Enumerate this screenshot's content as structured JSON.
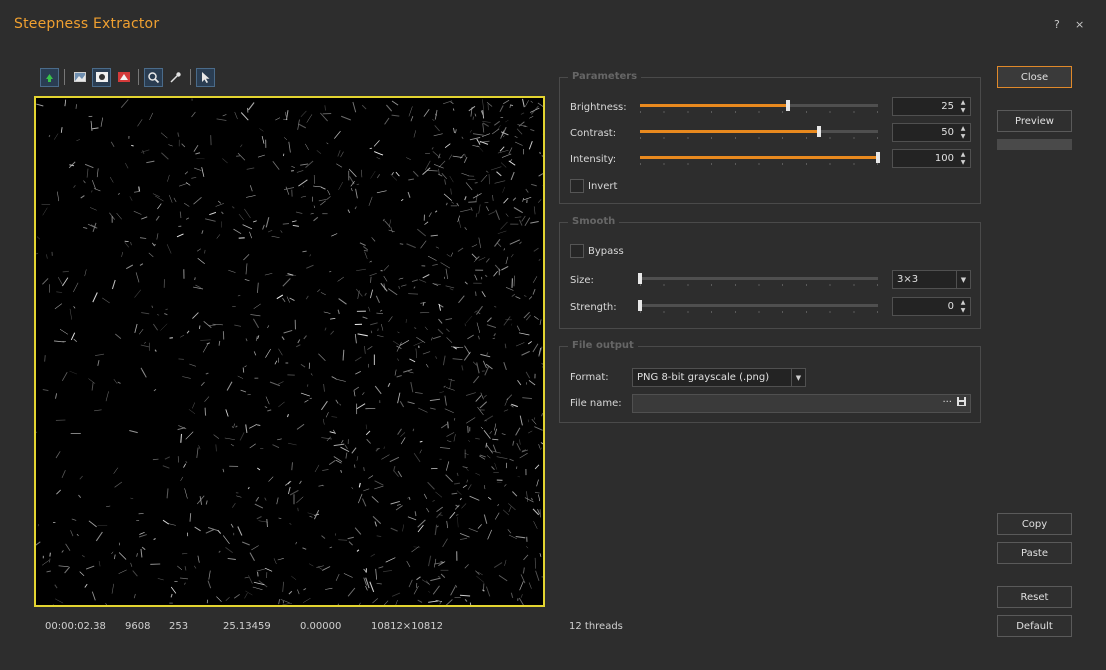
{
  "window": {
    "title": "Steepness Extractor",
    "help_label": "?",
    "close_label": "×"
  },
  "toolbar": {
    "icons": [
      "green-arrow-icon",
      "image-icon",
      "image-swap-icon",
      "image-red-icon",
      "zoom-icon",
      "eyedropper-icon",
      "pointer-icon"
    ]
  },
  "status": {
    "time": "00:00:02.38",
    "value1": "9608",
    "value2": "253",
    "value3": "25.13459",
    "value4": "0.00000",
    "dimensions": "10812×10812",
    "threads": "12 threads"
  },
  "parameters": {
    "title": "Parameters",
    "brightness": {
      "label": "Brightness:",
      "value": "25",
      "fraction": 0.62
    },
    "contrast": {
      "label": "Contrast:",
      "value": "50",
      "fraction": 0.75
    },
    "intensity": {
      "label": "Intensity:",
      "value": "100",
      "fraction": 1.0
    },
    "invert_label": "Invert"
  },
  "smooth": {
    "title": "Smooth",
    "bypass_label": "Bypass",
    "size": {
      "label": "Size:",
      "value": "3×3",
      "fraction": 0.0
    },
    "strength": {
      "label": "Strength:",
      "value": "0",
      "fraction": 0.0
    }
  },
  "file_output": {
    "title": "File output",
    "format_label": "Format:",
    "format_value": "PNG 8-bit grayscale (.png)",
    "filename_label": "File name:",
    "filename_value": "",
    "browse_label": "···",
    "save_label": "▪"
  },
  "buttons": {
    "close": "Close",
    "preview": "Preview",
    "copy": "Copy",
    "paste": "Paste",
    "reset": "Reset",
    "default": "Default"
  },
  "colors": {
    "accent": "#e8891e",
    "title": "#f0a030",
    "frame": "#e3d430"
  }
}
